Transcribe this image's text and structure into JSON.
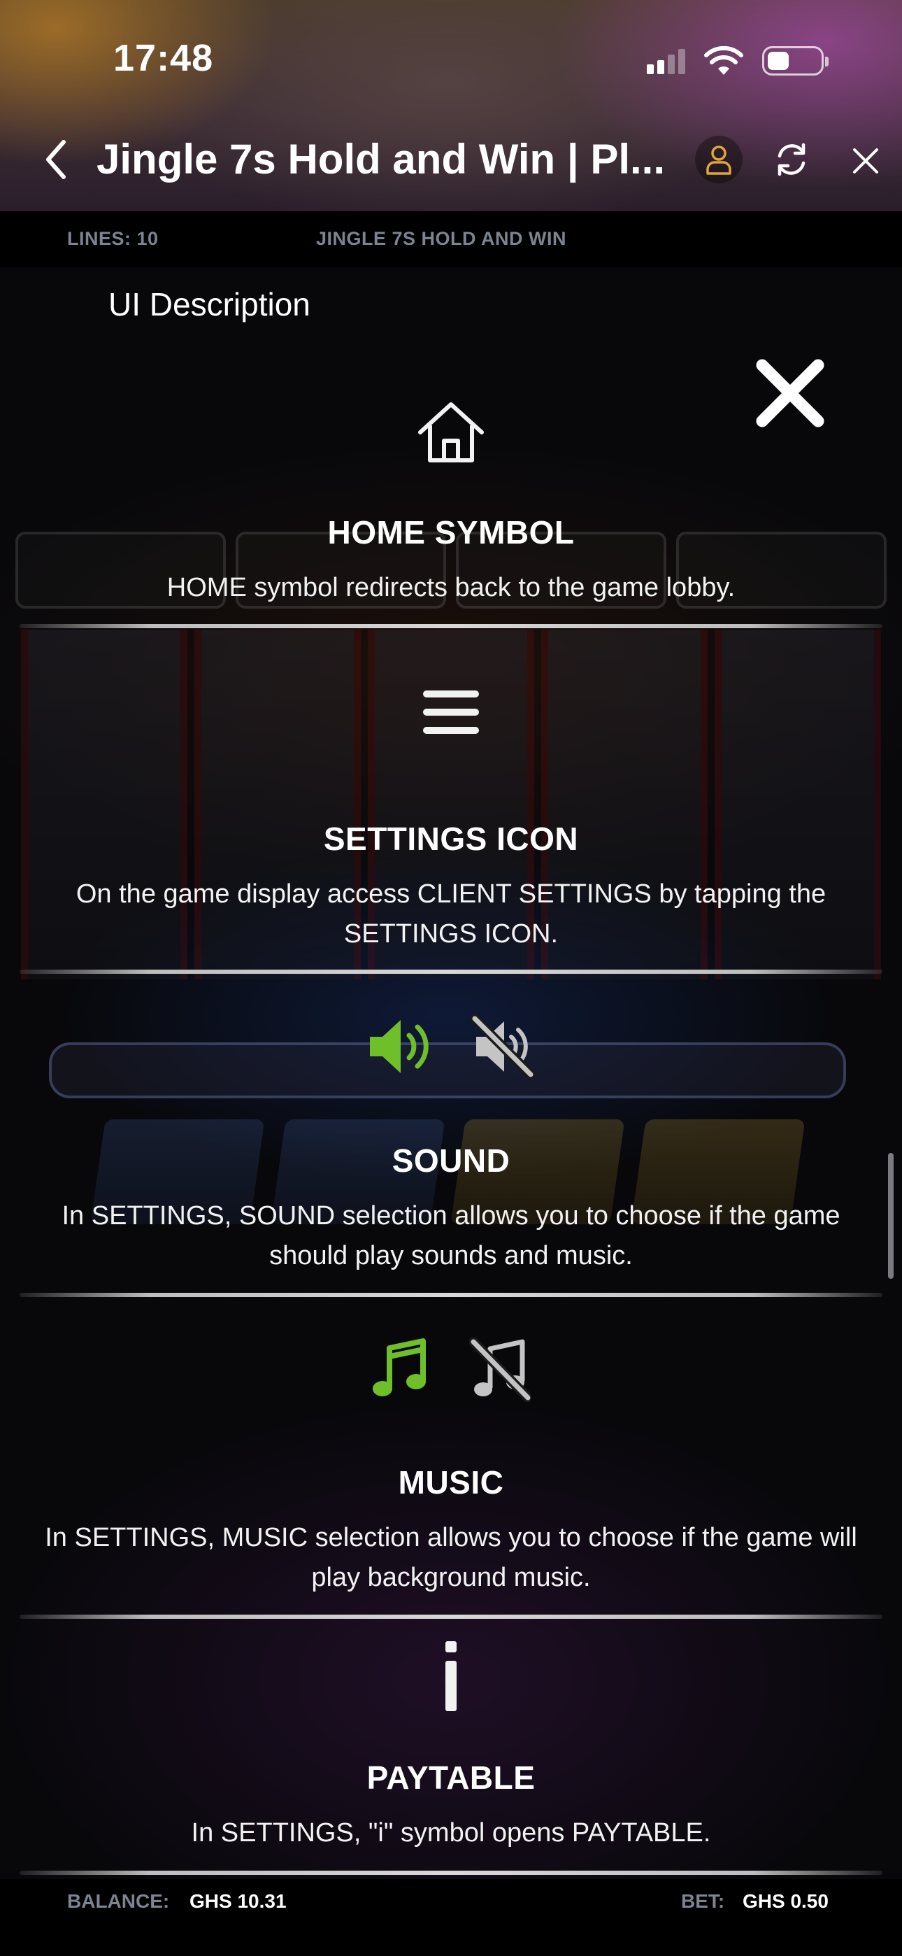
{
  "status_bar": {
    "time": "17:48"
  },
  "header": {
    "title": "Jingle 7s Hold and Win | Pl...",
    "back_icon": "chevron-left-icon",
    "account_icon": "user-icon",
    "refresh_icon": "refresh-icon",
    "close_icon": "close-icon",
    "account_icon_color": "#e0a63a"
  },
  "info_bar": {
    "lines": "LINES: 10",
    "game_name": "JINGLE 7S HOLD AND WIN"
  },
  "panel": {
    "header": "UI Description",
    "close_icon": "close-icon"
  },
  "sections": [
    {
      "icon": "home-icon",
      "title": "HOME SYMBOL",
      "description": "HOME symbol redirects back to the game lobby."
    },
    {
      "icon": "menu-icon",
      "title": "SETTINGS ICON",
      "description": "On the game display access CLIENT SETTINGS by tapping the SETTINGS ICON."
    },
    {
      "icons": [
        "sound-on-icon",
        "sound-off-icon"
      ],
      "title": "SOUND",
      "description": "In SETTINGS, SOUND selection allows you to choose if the game should play sounds and music."
    },
    {
      "icons": [
        "music-on-icon",
        "music-off-icon"
      ],
      "title": "MUSIC",
      "description": "In SETTINGS, MUSIC selection allows you to choose if the game will play background music."
    },
    {
      "icon": "info-icon",
      "title": "PAYTABLE",
      "description": "In SETTINGS, \"i\" symbol opens PAYTABLE."
    }
  ],
  "footer": {
    "balance_label": "BALANCE:",
    "balance_value": "GHS 10.31",
    "bet_label": "BET:",
    "bet_value": "GHS 0.50"
  },
  "colors": {
    "accent_green": "#6fbf2a",
    "muted_text": "#7d8390",
    "background": "#050507"
  }
}
